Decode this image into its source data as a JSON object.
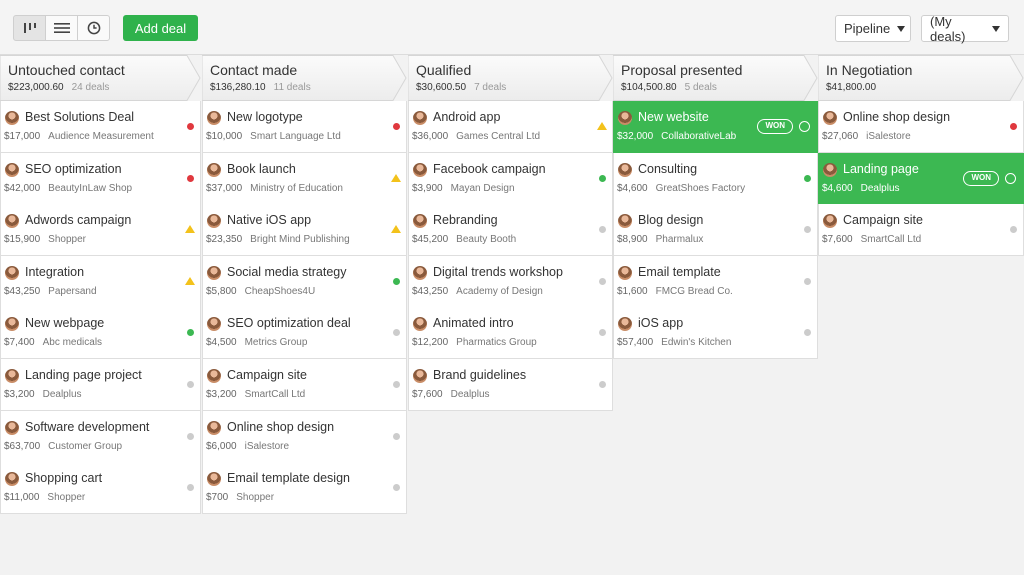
{
  "toolbar": {
    "view_icons": [
      "pipeline-view-icon",
      "list-view-icon",
      "timeline-view-icon"
    ],
    "add_deal_label": "Add deal",
    "pipeline_label": "Pipeline",
    "filter_label": "(My deals)"
  },
  "colors": {
    "accent": "#2fb24c",
    "won": "#3cb852",
    "red": "#e0383e",
    "yellow": "#f3c21b",
    "grey": "#cccccc"
  },
  "stages": [
    {
      "title": "Untouched contact",
      "total": "$223,000.60",
      "count": "24 deals",
      "deals": [
        {
          "title": "Best Solutions Deal",
          "value": "$17,000",
          "org": "Audience Measurement",
          "status": "red"
        },
        {
          "title": "SEO optimization",
          "value": "$42,000",
          "org": "BeautyInLaw Shop",
          "status": "red"
        },
        {
          "title": "Adwords campaign",
          "value": "$15,900",
          "org": "Shopper",
          "status": "yellow"
        },
        {
          "title": "Integration",
          "value": "$43,250",
          "org": "Papersand",
          "status": "yellow"
        },
        {
          "title": "New webpage",
          "value": "$7,400",
          "org": "Abc medicals",
          "status": "green"
        },
        {
          "title": "Landing page project",
          "value": "$3,200",
          "org": "Dealplus",
          "status": "grey"
        },
        {
          "title": "Software development",
          "value": "$63,700",
          "org": "Customer Group",
          "status": "grey"
        },
        {
          "title": "Shopping cart",
          "value": "$11,000",
          "org": "Shopper",
          "status": "grey"
        }
      ]
    },
    {
      "title": "Contact made",
      "total": "$136,280.10",
      "count": "11 deals",
      "deals": [
        {
          "title": "New logotype",
          "value": "$10,000",
          "org": "Smart Language Ltd",
          "status": "red"
        },
        {
          "title": "Book launch",
          "value": "$37,000",
          "org": "Ministry of Education",
          "status": "yellow"
        },
        {
          "title": "Native iOS app",
          "value": "$23,350",
          "org": "Bright Mind Publishing",
          "status": "yellow"
        },
        {
          "title": "Social media strategy",
          "value": "$5,800",
          "org": "CheapShoes4U",
          "status": "green"
        },
        {
          "title": "SEO optimization deal",
          "value": "$4,500",
          "org": "Metrics Group",
          "status": "grey"
        },
        {
          "title": "Campaign site",
          "value": "$3,200",
          "org": "SmartCall Ltd",
          "status": "grey"
        },
        {
          "title": "Online shop design",
          "value": "$6,000",
          "org": "iSalestore",
          "status": "grey"
        },
        {
          "title": "Email template design",
          "value": "$700",
          "org": "Shopper",
          "status": "grey"
        }
      ]
    },
    {
      "title": "Qualified",
      "total": "$30,600.50",
      "count": "7 deals",
      "deals": [
        {
          "title": "Android app",
          "value": "$36,000",
          "org": "Games Central Ltd",
          "status": "yellow"
        },
        {
          "title": "Facebook campaign",
          "value": "$3,900",
          "org": "Mayan Design",
          "status": "green"
        },
        {
          "title": "Rebranding",
          "value": "$45,200",
          "org": "Beauty Booth",
          "status": "grey"
        },
        {
          "title": "Digital trends workshop",
          "value": "$43,250",
          "org": "Academy of Design",
          "status": "grey"
        },
        {
          "title": "Animated intro",
          "value": "$12,200",
          "org": "Pharmatics Group",
          "status": "grey"
        },
        {
          "title": "Brand guidelines",
          "value": "$7,600",
          "org": "Dealplus",
          "status": "grey"
        }
      ]
    },
    {
      "title": "Proposal presented",
      "total": "$104,500.80",
      "count": "5 deals",
      "deals": [
        {
          "title": "New website",
          "value": "$32,000",
          "org": "CollaborativeLab",
          "status": "won",
          "badge": "WON"
        },
        {
          "title": "Consulting",
          "value": "$4,600",
          "org": "GreatShoes Factory",
          "status": "green"
        },
        {
          "title": "Blog design",
          "value": "$8,900",
          "org": "Pharmalux",
          "status": "grey"
        },
        {
          "title": "Email template",
          "value": "$1,600",
          "org": "FMCG Bread Co.",
          "status": "grey"
        },
        {
          "title": "iOS app",
          "value": "$57,400",
          "org": "Edwin's Kitchen",
          "status": "grey"
        }
      ]
    },
    {
      "title": "In Negotiation",
      "total": "$41,800.00",
      "count": "",
      "deals": [
        {
          "title": "Online shop design",
          "value": "$27,060",
          "org": "iSalestore",
          "status": "red"
        },
        {
          "title": "Landing page",
          "value": "$4,600",
          "org": "Dealplus",
          "status": "won",
          "badge": "WON"
        },
        {
          "title": "Campaign site",
          "value": "$7,600",
          "org": "SmartCall Ltd",
          "status": "grey"
        }
      ]
    }
  ]
}
